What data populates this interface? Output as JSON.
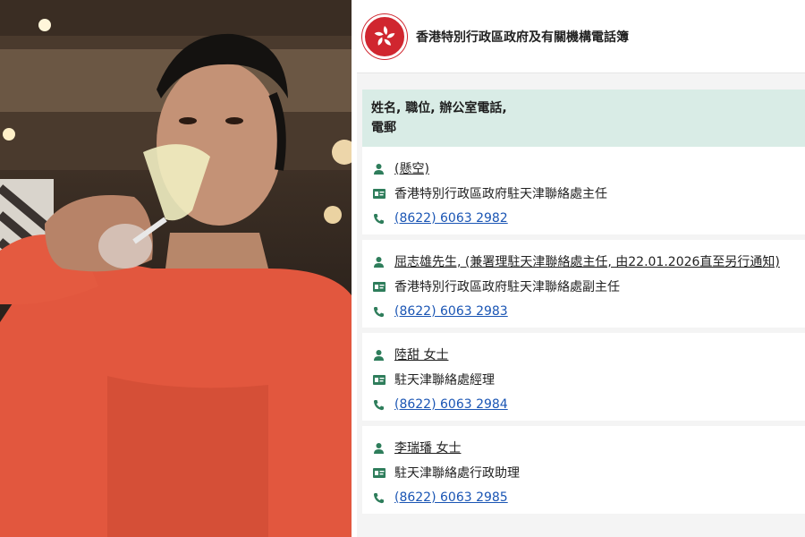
{
  "site": {
    "title": "香港特別行政區政府及有關機構電話簿"
  },
  "table_header": {
    "line1": "姓名, 職位, 辦公室電話,",
    "line2": "電郵"
  },
  "entries": [
    {
      "name": "(懸空)",
      "position": "香港特別行政區政府駐天津聯絡處主任",
      "phone": "(8622) 6063 2982"
    },
    {
      "name": "屈志雄先生, (兼署理駐天津聯絡處主任, 由22.01.2026直至另行通知)",
      "position": "香港特別行政區政府駐天津聯絡處副主任",
      "phone": "(8622) 6063 2983"
    },
    {
      "name": "陸甜 女士",
      "position": "駐天津聯絡處經理",
      "phone": "(8622) 6063 2984"
    },
    {
      "name": "李瑞璠 女士",
      "position": "駐天津聯絡處行政助理",
      "phone": "(8622) 6063 2985"
    }
  ],
  "colors": {
    "accent_green": "#2e7d5b",
    "link_blue": "#1a55b4",
    "header_bg": "#d9ece6",
    "emblem_red": "#d0262f"
  },
  "icons": {
    "person": "person-icon",
    "position": "id-card-icon",
    "phone": "phone-icon",
    "emblem": "hk-emblem-icon"
  }
}
